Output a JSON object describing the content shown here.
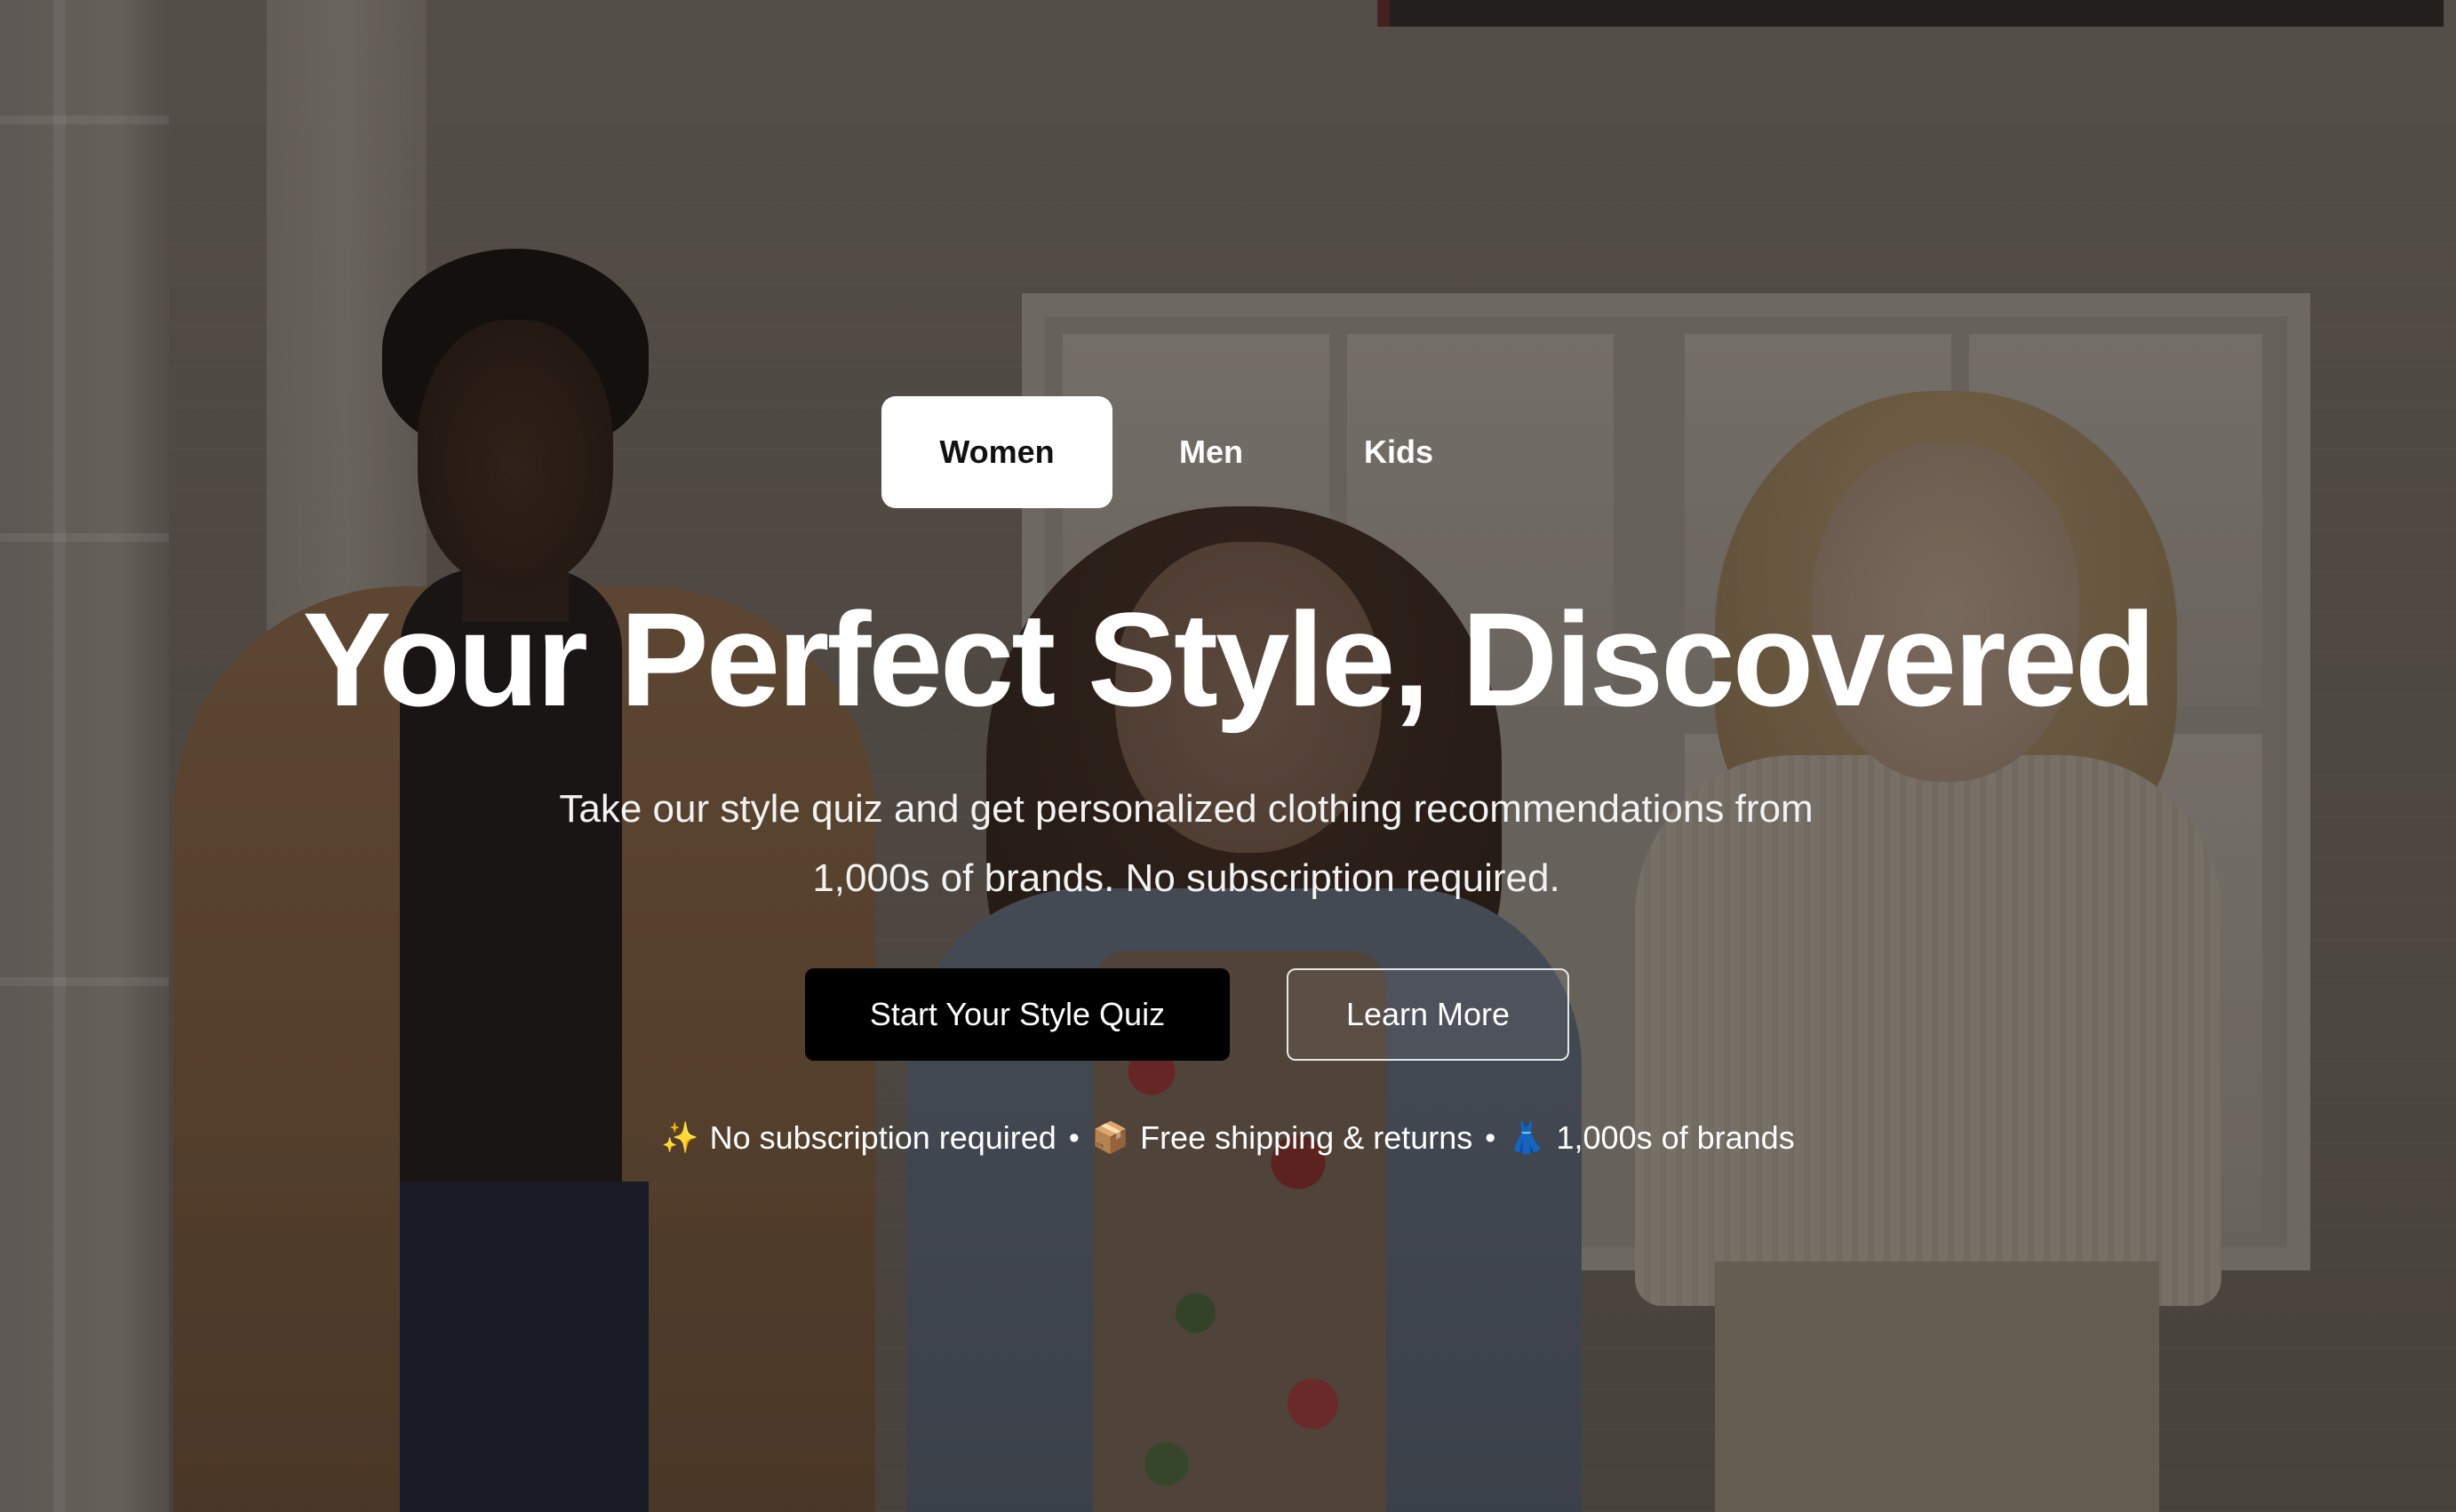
{
  "tabs": [
    {
      "label": "Women",
      "active": true
    },
    {
      "label": "Men",
      "active": false
    },
    {
      "label": "Kids",
      "active": false
    }
  ],
  "hero": {
    "headline": "Your Perfect Style, Discovered",
    "subtitle_line1": "Take our style quiz and get personalized clothing recommendations from",
    "subtitle_line2": "1,000s of brands. No subscription required."
  },
  "buttons": {
    "primary_label": "Start Your Style Quiz",
    "secondary_label": "Learn More"
  },
  "perks": [
    {
      "icon": "sparkles-icon",
      "glyph": "✨",
      "label": "No subscription required"
    },
    {
      "icon": "package-icon",
      "glyph": "📦",
      "label": "Free shipping & returns"
    },
    {
      "icon": "dress-icon",
      "glyph": "👗",
      "label": "1,000s of brands"
    }
  ],
  "separator": "•",
  "colors": {
    "primary_button_bg": "#000000",
    "text": "#ffffff",
    "active_tab_bg": "#ffffff"
  }
}
